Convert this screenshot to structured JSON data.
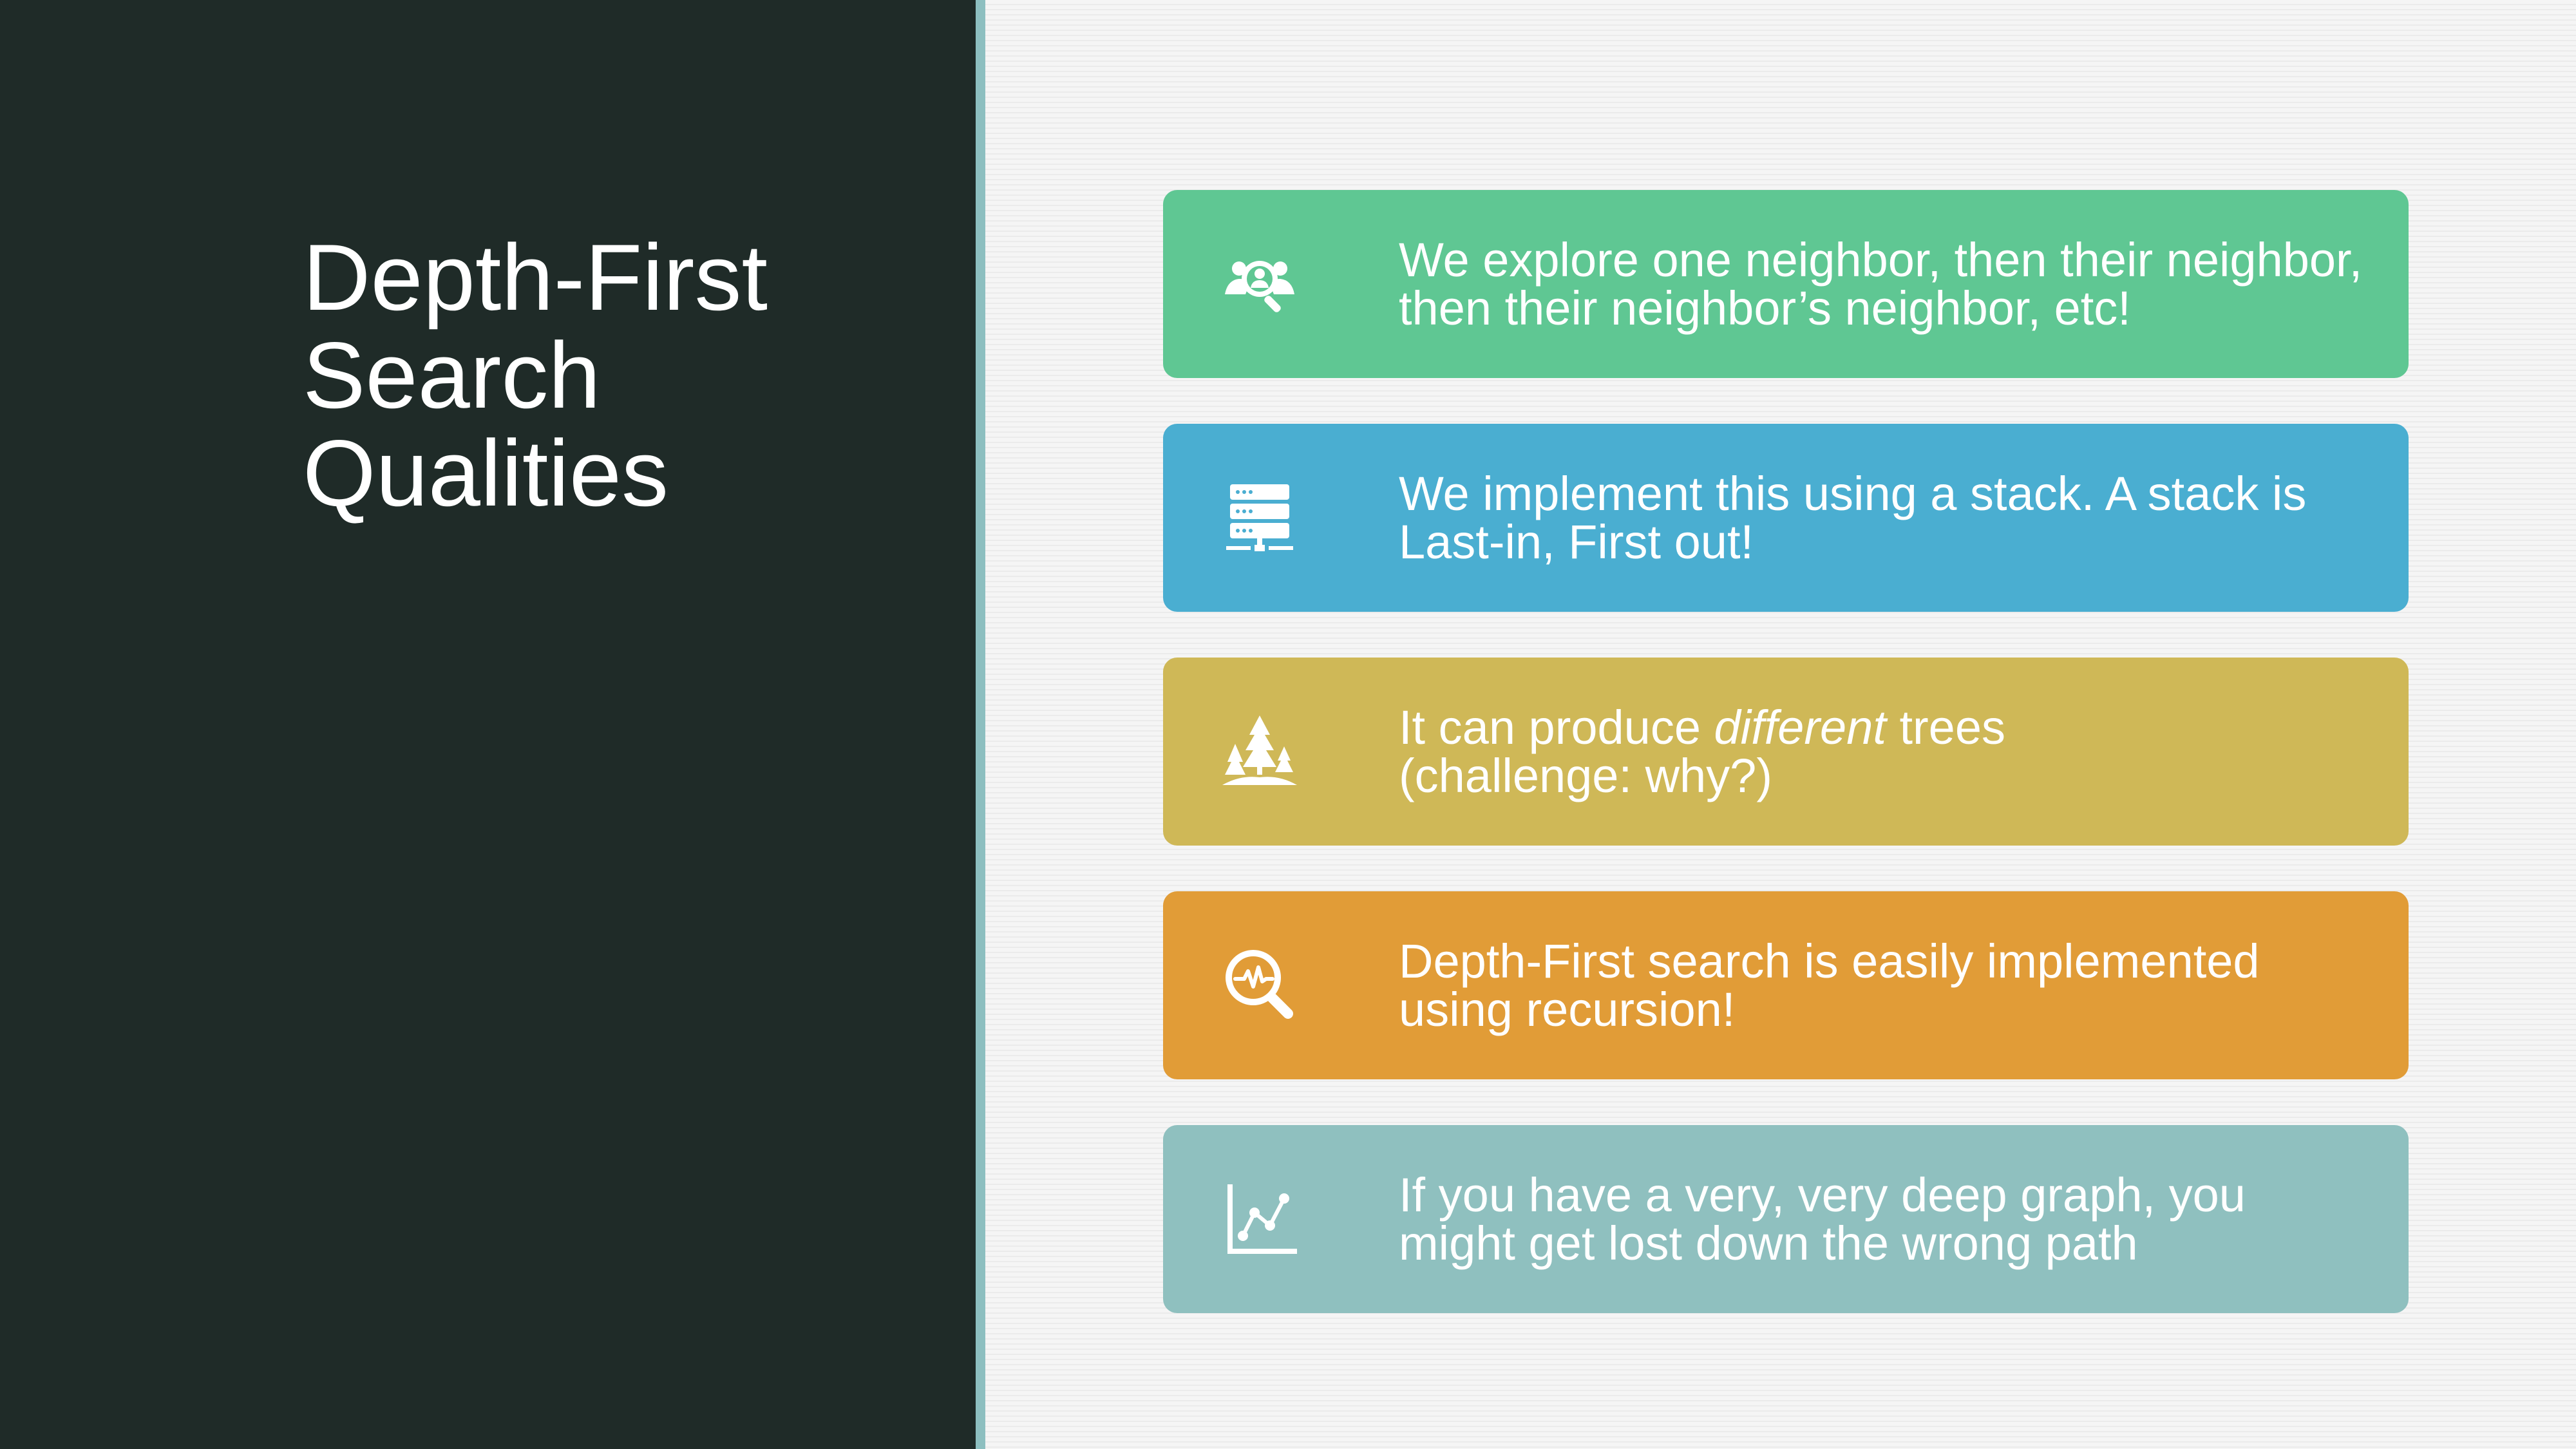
{
  "slide": {
    "title_lines": [
      "Depth-First",
      "Search",
      "Qualities"
    ]
  },
  "cards": [
    {
      "icon": "people-search-icon",
      "color": "#5fc793",
      "lines": [
        "We explore one neighbor, then their neighbor,",
        "then their neighbor’s neighbor, etc!"
      ]
    },
    {
      "icon": "server-stack-icon",
      "color": "#4aaed1",
      "lines": [
        "We implement this using a stack. A stack is",
        "Last-in, First out!"
      ]
    },
    {
      "icon": "trees-icon",
      "color": "#cfb857",
      "line1_before": "It can produce ",
      "line1_emphasis": "different",
      "line1_after": " trees",
      "line2": "(challenge: why?)"
    },
    {
      "icon": "magnifier-pulse-icon",
      "color": "#e19c37",
      "lines": [
        "Depth-First search is easily implemented",
        "using recursion!"
      ]
    },
    {
      "icon": "line-chart-icon",
      "color": "#8fc0bf",
      "lines": [
        "If you have a very, very deep graph, you",
        "might get lost down the wrong path"
      ]
    }
  ],
  "colors": {
    "left_panel": "#1f2b28",
    "divider": "#8dbfc0",
    "background": "#f3f3f3"
  }
}
